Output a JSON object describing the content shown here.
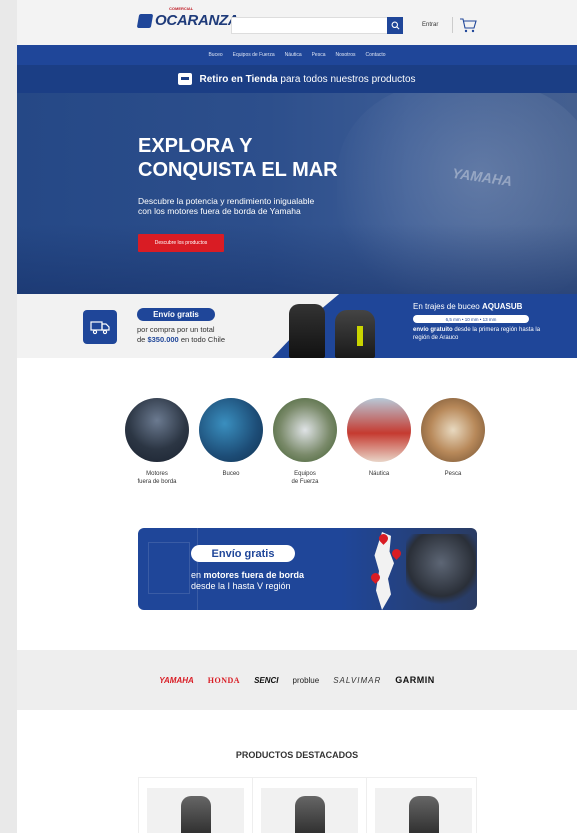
{
  "header": {
    "logo_small": "COMERCIAL",
    "logo_text": "OCARANZA",
    "search_placeholder": "",
    "login_label": "Entrar"
  },
  "nav": {
    "items": [
      "Buceo",
      "Equipos de Fuerza",
      "Náutica",
      "Pesca",
      "Nosotros",
      "Contacto"
    ]
  },
  "pickup": {
    "bold": "Retiro en Tienda",
    "rest": " para todos nuestros productos"
  },
  "hero": {
    "title_line1": "EXPLORA Y",
    "title_line2": "CONQUISTA EL MAR",
    "sub_line1": "Descubre la potencia y rendimiento inigualable",
    "sub_line2": "con los motores fuera de borda de Yamaha",
    "button": "Descubre los productos",
    "brand_text": "YAMAHA"
  },
  "shipping": {
    "pill": "Envío gratis",
    "line1": "por compra por un total",
    "line2_prefix": "de ",
    "line2_amount": "$350.000",
    "line2_suffix": " en todo Chile",
    "right_title_prefix": "En trajes de buceo ",
    "right_title_brand": "AQUASUB",
    "sizes": "6,5 mm  •  10 mm  •  13 mm",
    "right_bold": "envío gratuito",
    "right_rest": " desde la primera región hasta la región de Arauco"
  },
  "categories": [
    {
      "label_1": "Motores",
      "label_2": "fuera de borda"
    },
    {
      "label_1": "Buceo",
      "label_2": ""
    },
    {
      "label_1": "Equipos",
      "label_2": "de Fuerza"
    },
    {
      "label_1": "Náutica",
      "label_2": ""
    },
    {
      "label_1": "Pesca",
      "label_2": ""
    }
  ],
  "free_ship_card": {
    "pill": "Envío gratis",
    "line1_prefix": "en ",
    "line1_bold": "motores fuera de borda",
    "line2": "desde la I hasta V región"
  },
  "brands": [
    "YAMAHA",
    "HONDA",
    "SENCI",
    "problue",
    "SALVIMAR",
    "GARMIN"
  ],
  "products": {
    "title": "PRODUCTOS DESTACADOS"
  },
  "colors": {
    "primary": "#1f4699",
    "accent_red": "#d91c24",
    "pickup_bg": "#1b3e85"
  }
}
